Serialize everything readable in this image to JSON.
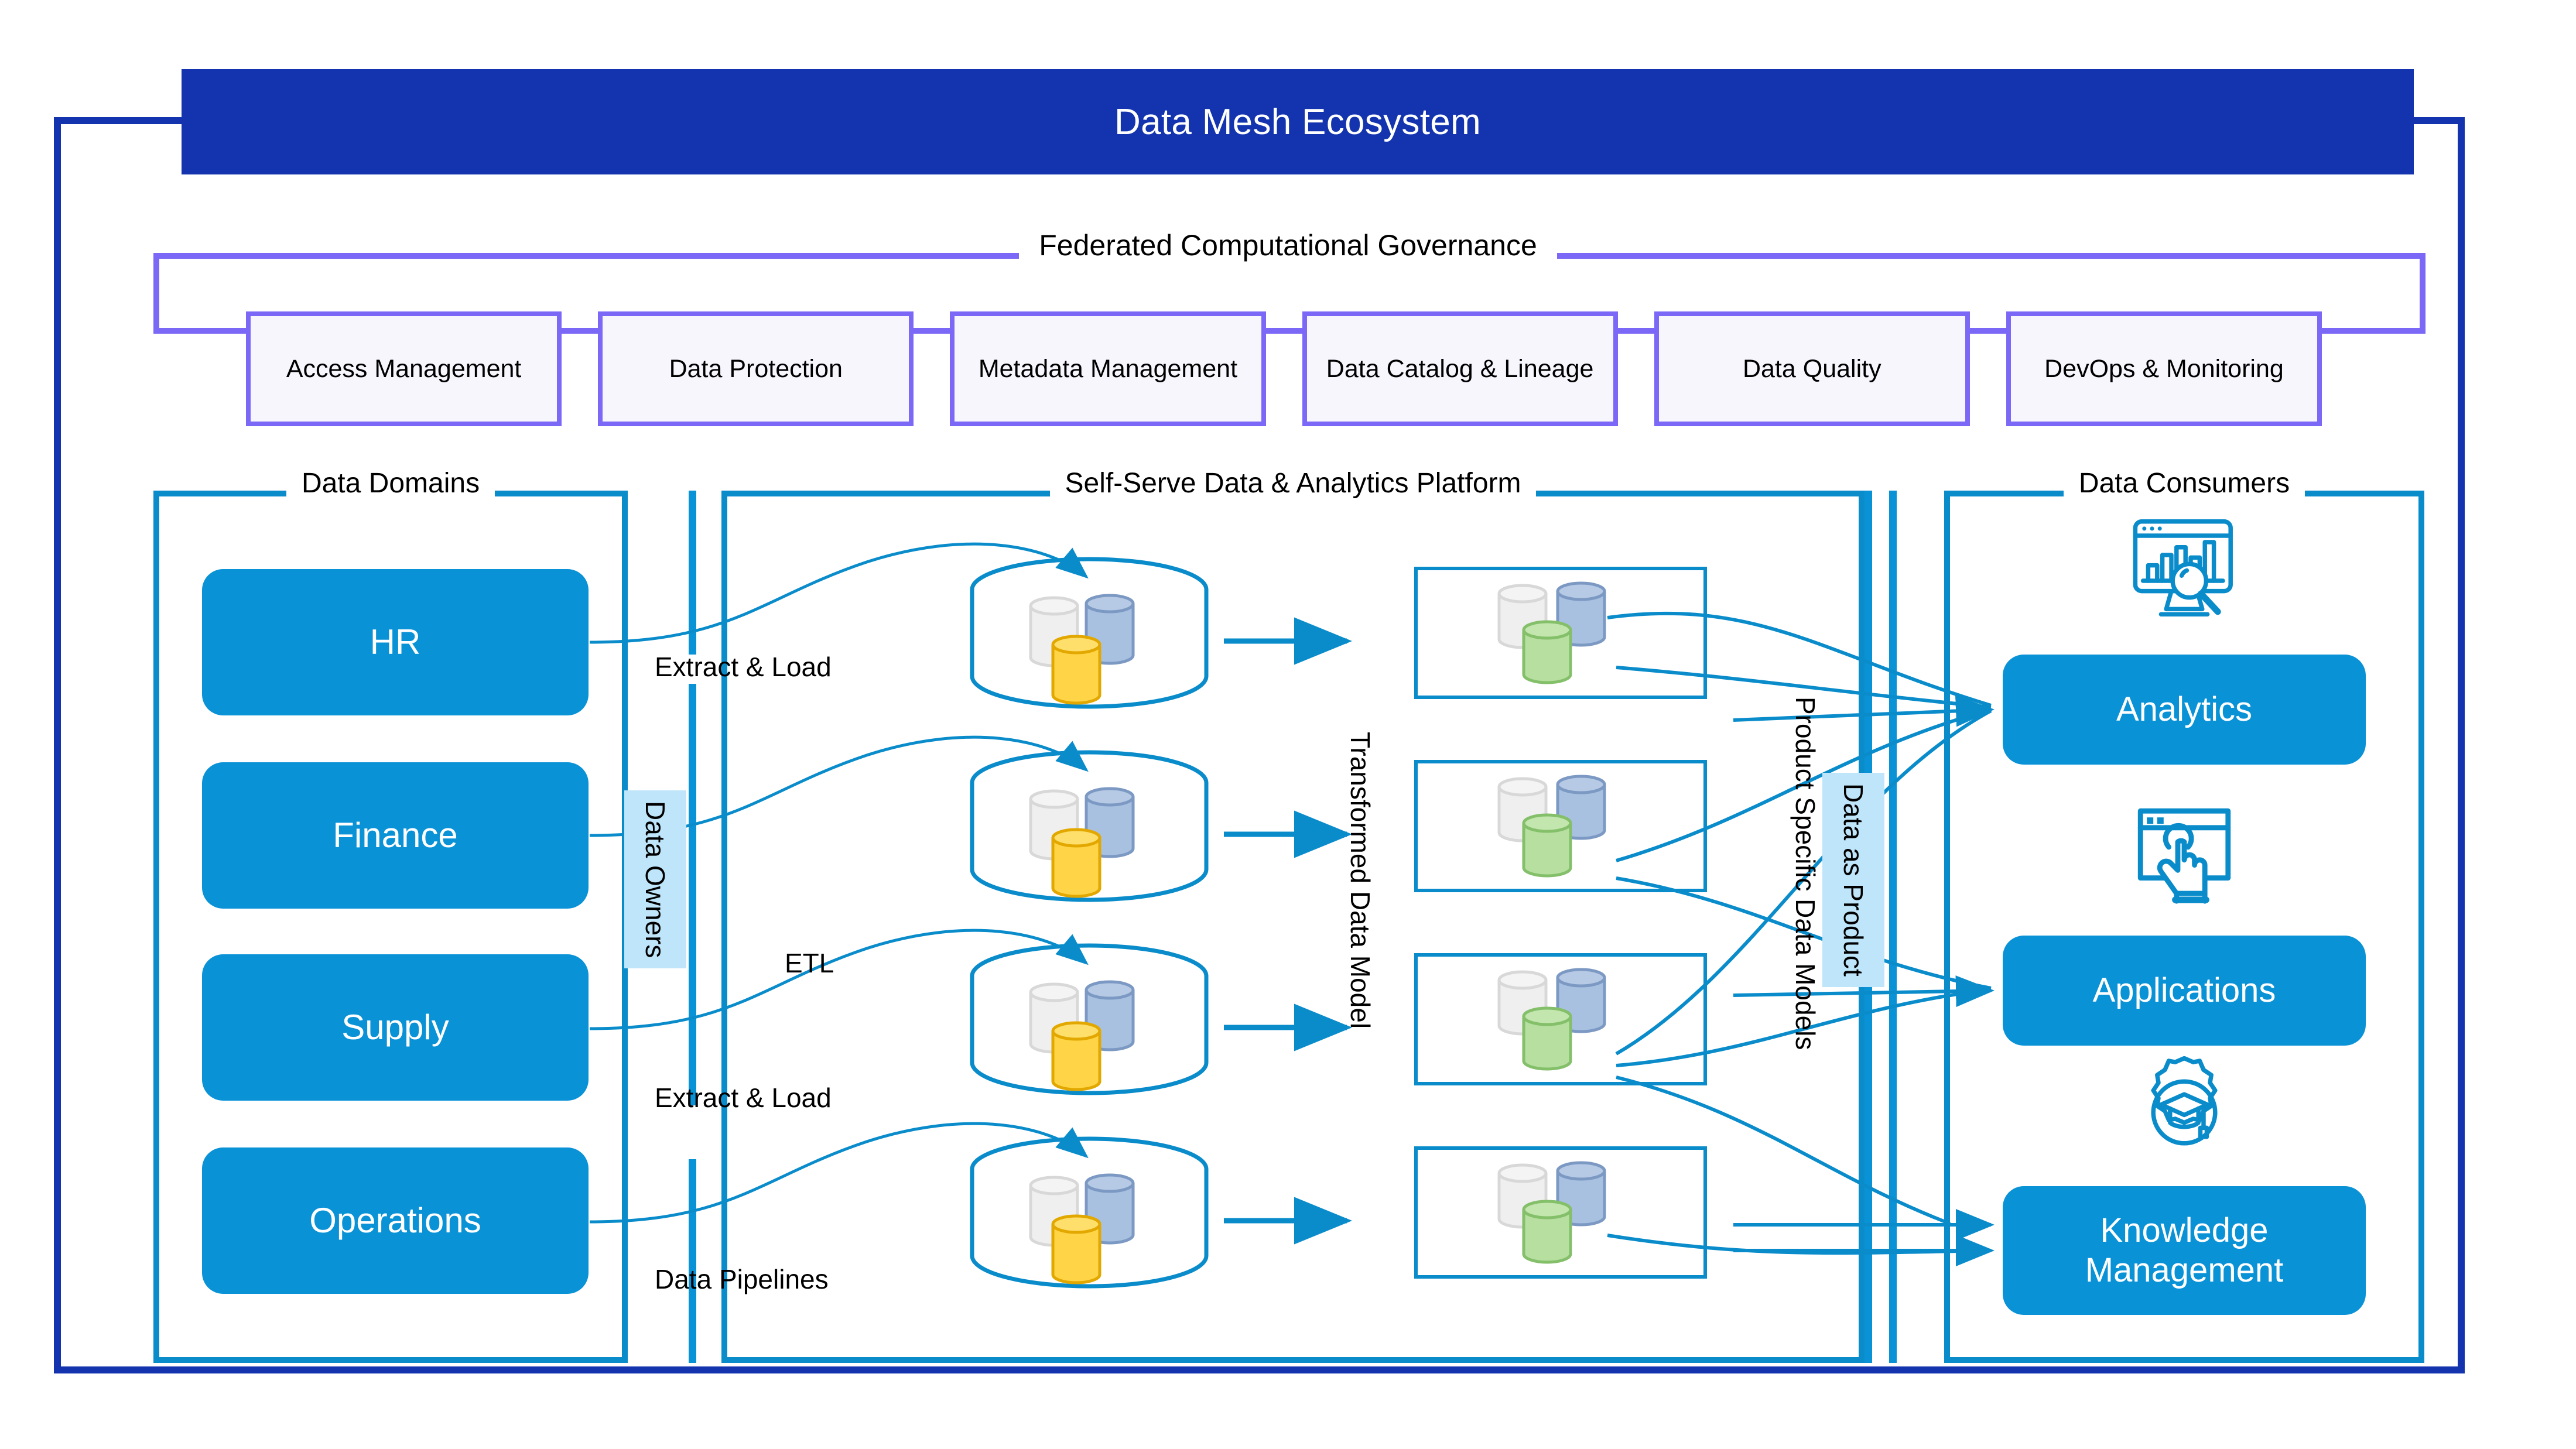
{
  "header": {
    "title": "Data Mesh Ecosystem"
  },
  "governance": {
    "title": "Federated Computational Governance",
    "items": [
      {
        "label": "Access Management"
      },
      {
        "label": "Data Protection"
      },
      {
        "label": "Metadata Management"
      },
      {
        "label": "Data Catalog & Lineage"
      },
      {
        "label": "Data Quality"
      },
      {
        "label": "DevOps & Monitoring"
      }
    ]
  },
  "domains": {
    "title": "Data Domains",
    "items": [
      {
        "label": "HR"
      },
      {
        "label": "Finance"
      },
      {
        "label": "Supply"
      },
      {
        "label": "Operations"
      }
    ]
  },
  "platform": {
    "title": "Self-Serve Data & Analytics Platform",
    "labels": {
      "data_owners": "Data Owners",
      "extract_load_top": "Extract & Load",
      "etl": "ETL",
      "extract_load_bottom": "Extract & Load",
      "data_pipelines": "Data Pipelines",
      "transformed_data_model": "Transformed Data Model",
      "product_specific_data_models": "Product Specific Data Models",
      "data_as_product": "Data as Product"
    },
    "source_stores": [
      {
        "name": "source-store-1",
        "inner": [
          "gray",
          "blue",
          "yellow"
        ]
      },
      {
        "name": "source-store-2",
        "inner": [
          "gray",
          "blue",
          "yellow"
        ]
      },
      {
        "name": "source-store-3",
        "inner": [
          "gray",
          "blue",
          "yellow"
        ]
      },
      {
        "name": "source-store-4",
        "inner": [
          "gray",
          "blue",
          "yellow"
        ]
      }
    ],
    "transformed_models": [
      {
        "name": "transformed-model-1",
        "inner": [
          "gray",
          "blue",
          "green"
        ]
      },
      {
        "name": "transformed-model-2",
        "inner": [
          "gray",
          "blue",
          "green"
        ]
      },
      {
        "name": "transformed-model-3",
        "inner": [
          "gray",
          "blue",
          "green"
        ]
      },
      {
        "name": "transformed-model-4",
        "inner": [
          "gray",
          "blue",
          "green"
        ]
      }
    ]
  },
  "consumers": {
    "title": "Data Consumers",
    "items": [
      {
        "label": "Analytics",
        "icon": "analytics-dashboard-search-icon"
      },
      {
        "label": "Applications",
        "icon": "browser-tap-hand-icon"
      },
      {
        "label": "Knowledge Management",
        "icon": "gear-graduation-cap-icon"
      }
    ]
  },
  "colors": {
    "header_blue": "#1334AE",
    "accent_blue": "#0A92D6",
    "line_blue": "#0A8CCB",
    "governance_purple": "#7B68F7",
    "governance_fill": "#F7F6FD",
    "light_blue_tag": "#BFE5FA",
    "cyl_gray": "#EFEFEF",
    "cyl_blue": "#A8C1E0",
    "cyl_yellow": "#FFD547",
    "cyl_green": "#B6DFA0"
  }
}
